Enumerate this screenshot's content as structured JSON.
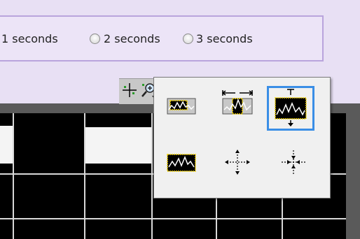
{
  "radio_options": [
    {
      "label": "1 seconds",
      "selected": false
    },
    {
      "label": "2 seconds",
      "selected": false
    },
    {
      "label": "3 seconds",
      "selected": false
    }
  ],
  "palette_tools": [
    {
      "icon": "cursor-crosshair-icon"
    },
    {
      "icon": "zoom-magnifier-icon"
    }
  ],
  "zoom_tools": [
    {
      "icon": "rectangle-zoom-icon",
      "selected": false
    },
    {
      "icon": "x-zoom-icon",
      "selected": false
    },
    {
      "icon": "y-zoom-icon",
      "selected": true
    },
    {
      "icon": "zoom-to-fit-icon",
      "selected": false
    },
    {
      "icon": "zoom-out-about-point-icon",
      "selected": false
    },
    {
      "icon": "zoom-in-about-point-icon",
      "selected": false
    }
  ],
  "colors": {
    "selection_border": "#3a8ee6",
    "plot_background": "#000000",
    "trace": "#f4f4f4",
    "panel_background": "#e8e0f4"
  }
}
